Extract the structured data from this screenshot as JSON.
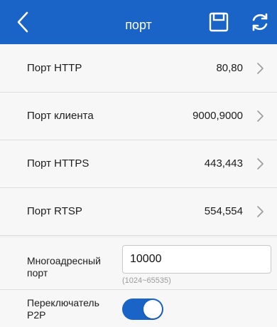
{
  "header": {
    "title": "порт",
    "back_icon": "chevron-left-icon",
    "save_icon": "save-floppy-icon",
    "refresh_icon": "refresh-icon",
    "background": "#1a64c8"
  },
  "ports": [
    {
      "label": "Порт HTTP",
      "value": "80,80"
    },
    {
      "label": "Порт клиента",
      "value": "9000,9000"
    },
    {
      "label": "Порт HTTPS",
      "value": "443,443"
    },
    {
      "label": "Порт RTSP",
      "value": "554,554"
    }
  ],
  "multicast": {
    "label": "Многоадресный порт",
    "value": "10000",
    "hint": "(1024~65535)"
  },
  "p2p": {
    "label": "Переключатель P2P",
    "enabled": true,
    "accent": "#1a64c8"
  }
}
